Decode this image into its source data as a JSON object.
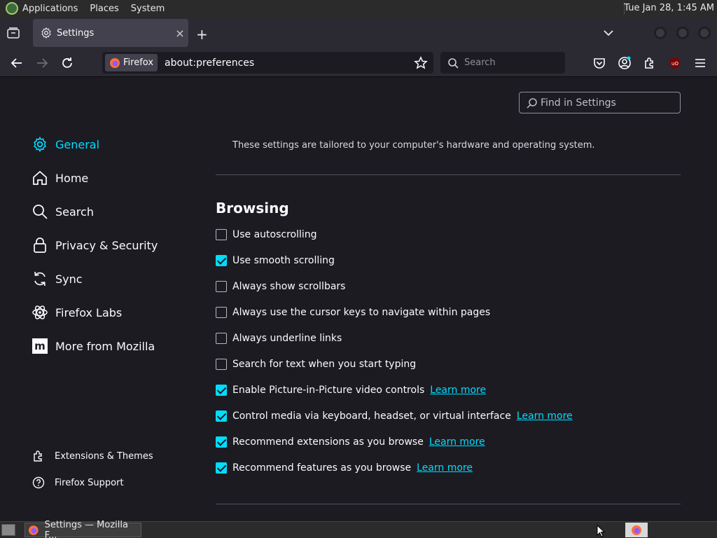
{
  "system_panel": {
    "menus": [
      "Applications",
      "Places",
      "System"
    ],
    "clock": "Tue Jan 28,  1:45 AM"
  },
  "browser": {
    "tab": {
      "title": "Settings",
      "close": "×"
    },
    "new_tab": "+",
    "identity_label": "Firefox",
    "url": "about:preferences",
    "search_placeholder": "Search"
  },
  "preferences": {
    "find_placeholder": "Find in Settings",
    "categories": [
      {
        "label": "General",
        "icon": "gear-icon",
        "selected": true
      },
      {
        "label": "Home",
        "icon": "home-icon"
      },
      {
        "label": "Search",
        "icon": "search-icon"
      },
      {
        "label": "Privacy & Security",
        "icon": "lock-icon"
      },
      {
        "label": "Sync",
        "icon": "sync-icon"
      },
      {
        "label": "Firefox Labs",
        "icon": "labs-icon"
      },
      {
        "label": "More from Mozilla",
        "icon": "mozilla-icon"
      }
    ],
    "footer": [
      {
        "label": "Extensions & Themes",
        "icon": "puzzle-icon"
      },
      {
        "label": "Firefox Support",
        "icon": "help-icon"
      }
    ],
    "tailored_note": "These settings are tailored to your computer's hardware and operating system.",
    "browsing": {
      "heading": "Browsing",
      "options": [
        {
          "label": "Use autoscrolling",
          "checked": false
        },
        {
          "label": "Use smooth scrolling",
          "checked": true
        },
        {
          "label": "Always show scrollbars",
          "checked": false
        },
        {
          "label": "Always use the cursor keys to navigate within pages",
          "checked": false
        },
        {
          "label": "Always underline links",
          "checked": false
        },
        {
          "label": "Search for text when you start typing",
          "checked": false
        },
        {
          "label": "Enable Picture-in-Picture video controls",
          "checked": true,
          "link": "Learn more"
        },
        {
          "label": "Control media via keyboard, headset, or virtual interface",
          "checked": true,
          "link": "Learn more"
        },
        {
          "label": "Recommend extensions as you browse",
          "checked": true,
          "link": "Learn more"
        },
        {
          "label": "Recommend features as you browse",
          "checked": true,
          "link": "Learn more"
        }
      ]
    }
  },
  "taskbar": {
    "task_label": "Settings — Mozilla F..."
  },
  "colors": {
    "accent": "#00ddff",
    "background": "#1c1b22",
    "toolbar": "#2b2a33"
  }
}
